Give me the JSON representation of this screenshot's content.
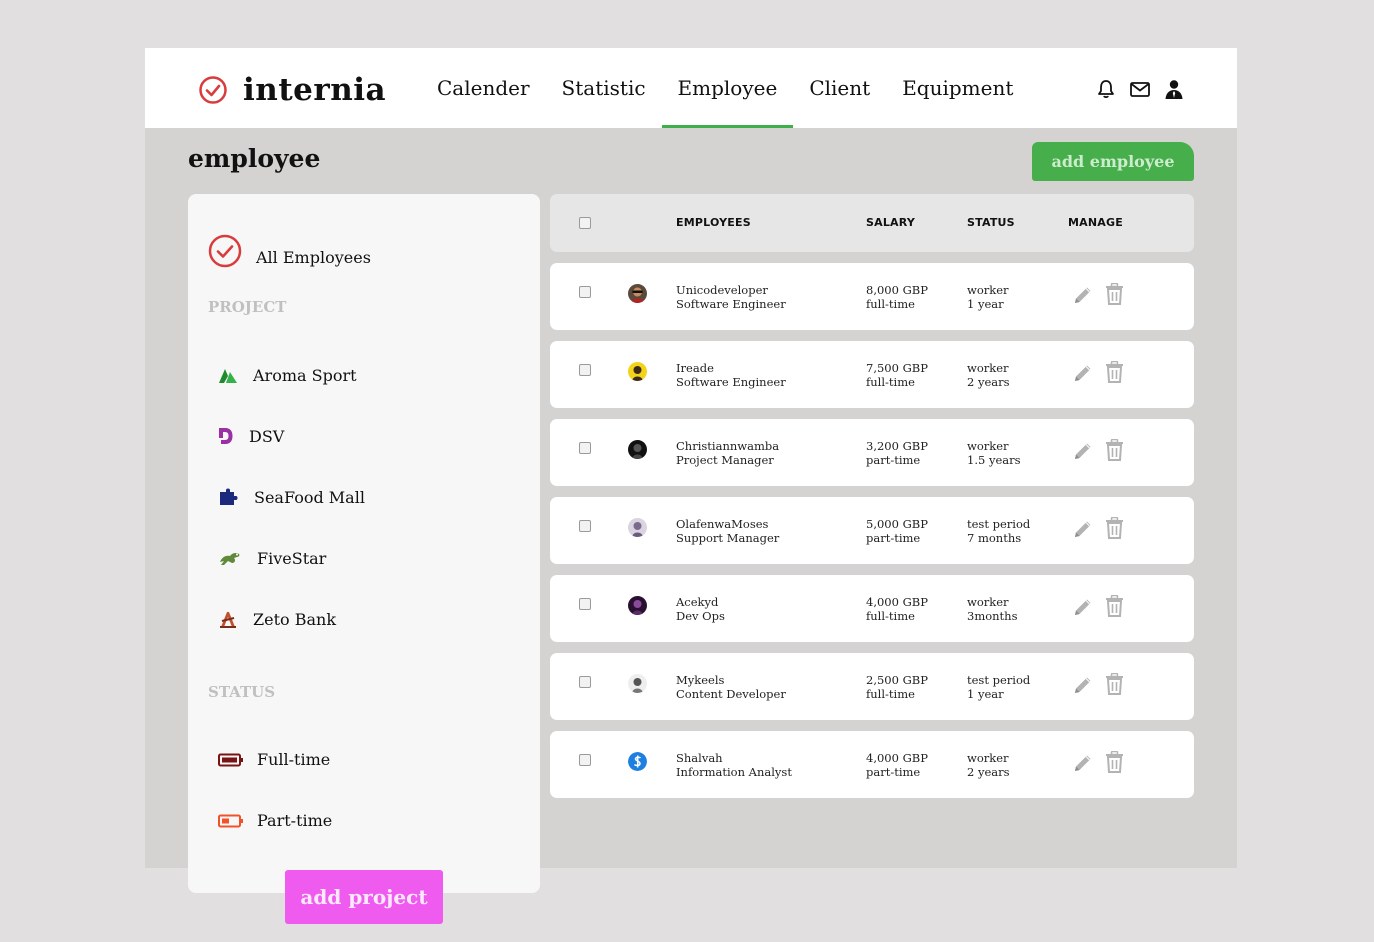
{
  "app": {
    "brand": "internia"
  },
  "nav": [
    {
      "label": "Calender"
    },
    {
      "label": "Statistic"
    },
    {
      "label": "Employee"
    },
    {
      "label": "Client"
    },
    {
      "label": "Equipment"
    }
  ],
  "header_icons": [
    "bell-icon",
    "mail-icon",
    "user-icon"
  ],
  "page": {
    "title": "employee",
    "add_employee_label": "add employee"
  },
  "sidebar": {
    "all_label": "All Employees",
    "project_heading": "PROJECT",
    "projects": [
      {
        "label": "Aroma Sport",
        "icon": "aroma-sport-logo-icon"
      },
      {
        "label": "DSV",
        "icon": "dsv-logo-icon"
      },
      {
        "label": "SeaFood Mall",
        "icon": "seafood-mall-logo-icon"
      },
      {
        "label": "FiveStar",
        "icon": "fivestar-logo-icon"
      },
      {
        "label": "Zeto Bank",
        "icon": "zeto-bank-logo-icon"
      }
    ],
    "status_heading": "STATUS",
    "statuses": [
      {
        "label": "Full-time",
        "icon": "battery-full-icon"
      },
      {
        "label": "Part-time",
        "icon": "battery-half-icon"
      }
    ],
    "add_project_label": "add project"
  },
  "table": {
    "headers": {
      "employees": "EMPLOYEES",
      "salary": "SALARY",
      "status": "STATUS",
      "manage": "MANAGE"
    },
    "rows": [
      {
        "name": "Unicodeveloper",
        "role": "Software Engineer",
        "salary": "8,000 GBP",
        "type": "full-time",
        "status": "worker",
        "duration": "1 year"
      },
      {
        "name": "Ireade",
        "role": "Software Engineer",
        "salary": "7,500 GBP",
        "type": "full-time",
        "status": "worker",
        "duration": "2 years"
      },
      {
        "name": "Christiannwamba",
        "role": "Project Manager",
        "salary": "3,200 GBP",
        "type": "part-time",
        "status": "worker",
        "duration": "1.5 years"
      },
      {
        "name": "OlafenwaMoses",
        "role": "Support Manager",
        "salary": "5,000 GBP",
        "type": "part-time",
        "status": "test period",
        "duration": "7 months"
      },
      {
        "name": "Acekyd",
        "role": "Dev Ops",
        "salary": "4,000 GBP",
        "type": "full-time",
        "status": "worker",
        "duration": "3months"
      },
      {
        "name": "Mykeels",
        "role": "Content Developer",
        "salary": "2,500 GBP",
        "type": "full-time",
        "status": "test period",
        "duration": "1 year"
      },
      {
        "name": "Shalvah",
        "role": "Information Analyst",
        "salary": "4,000 GBP",
        "type": "part-time",
        "status": "worker",
        "duration": "2 years"
      }
    ]
  },
  "colors": {
    "accent": "#46ae4b",
    "add_project": "#ef5bef",
    "logo_red": "#d93c3c",
    "background": "#d4d3d1"
  }
}
